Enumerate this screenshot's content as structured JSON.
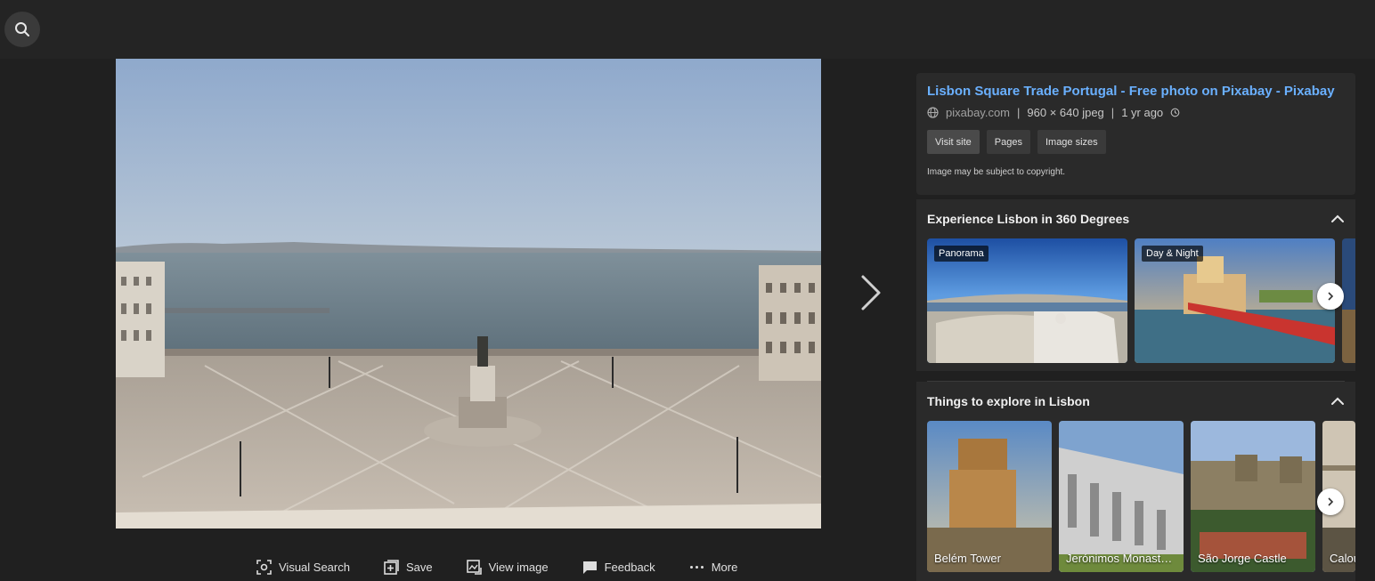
{
  "topbar": {
    "search_icon": "search-icon"
  },
  "image": {
    "alt": "Lisbon Praça do Comércio square overlooking the Tagus river"
  },
  "actions": [
    {
      "label": "Visual Search",
      "icon": "visual-search-icon"
    },
    {
      "label": "Save",
      "icon": "save-icon"
    },
    {
      "label": "View image",
      "icon": "view-image-icon"
    },
    {
      "label": "Feedback",
      "icon": "feedback-icon"
    },
    {
      "label": "More",
      "icon": "more-icon"
    }
  ],
  "details": {
    "title": "Lisbon Square Trade Portugal - Free photo on Pixabay - Pixabay",
    "domain": "pixabay.com",
    "dimensions": "960 × 640 jpeg",
    "age": "1 yr ago",
    "buttons": [
      "Visit site",
      "Pages",
      "Image sizes"
    ],
    "copyright": "Image may be subject to copyright."
  },
  "section1": {
    "title": "Experience Lisbon in 360 Degrees",
    "items": [
      {
        "tag": "Panorama"
      },
      {
        "tag": "Day & Night"
      }
    ]
  },
  "section2": {
    "title": "Things to explore in Lisbon",
    "items": [
      {
        "caption": "Belém Tower"
      },
      {
        "caption": "Jerónimos Monast…"
      },
      {
        "caption": "São Jorge Castle"
      },
      {
        "caption": "Calou"
      }
    ]
  },
  "colors": {
    "link": "#6ab0ff",
    "background": "#202020",
    "panel": "#2a2a2a"
  }
}
